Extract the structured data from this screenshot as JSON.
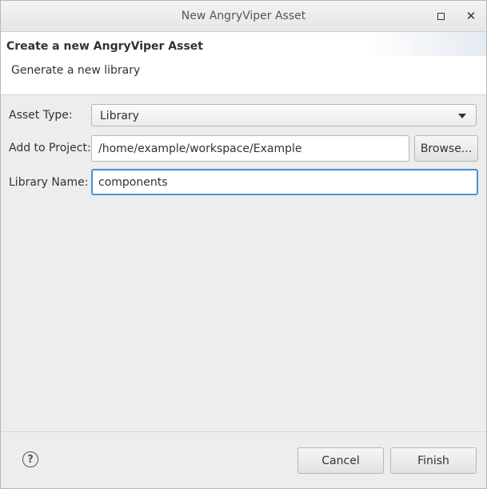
{
  "window": {
    "title": "New AngryViper Asset"
  },
  "banner": {
    "title": "Create a new AngryViper Asset",
    "description": "Generate a new library"
  },
  "form": {
    "asset_type_label": "Asset Type:",
    "asset_type_value": "Library",
    "project_label": "Add to Project:",
    "project_value": "/home/example/workspace/Example",
    "browse_label": "Browse...",
    "name_label": "Library Name:",
    "name_value": "components"
  },
  "footer": {
    "help_glyph": "?",
    "cancel_label": "Cancel",
    "finish_label": "Finish"
  },
  "icons": {
    "maximize": "maximize-icon",
    "close": "close-icon",
    "help": "help-icon",
    "dropdown": "chevron-down-icon"
  },
  "colors": {
    "focus_border": "#4a90d9",
    "background": "#ededed"
  }
}
